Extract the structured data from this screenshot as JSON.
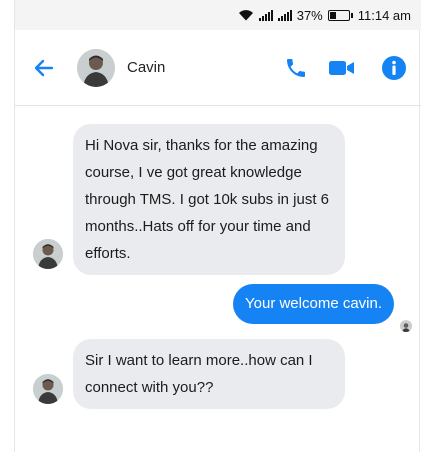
{
  "status_bar": {
    "icons": [
      "wifi-icon",
      "signal-icon",
      "signal-icon",
      "battery-icon"
    ],
    "battery": "37%",
    "battery_level": 0.37,
    "time": "11:14 am"
  },
  "header": {
    "contact_name": "Cavin",
    "icons": [
      "back-arrow-icon",
      "phone-icon",
      "video-call-icon",
      "info-icon"
    ],
    "accent_color": "#1583f3"
  },
  "messages": [
    {
      "from": "contact",
      "text": "Hi Nova sir, thanks for the amazing course, I ve got great knowledge through TMS. I got 10k subs in just 6 months..Hats off for your time and efforts."
    },
    {
      "from": "me",
      "text": "Your welcome cavin."
    },
    {
      "from": "contact",
      "text": "Sir I want to learn more..how can I connect with you??"
    }
  ],
  "colors": {
    "incoming_bubble": "#e9ebee",
    "outgoing_bubble": "#1583f3"
  }
}
